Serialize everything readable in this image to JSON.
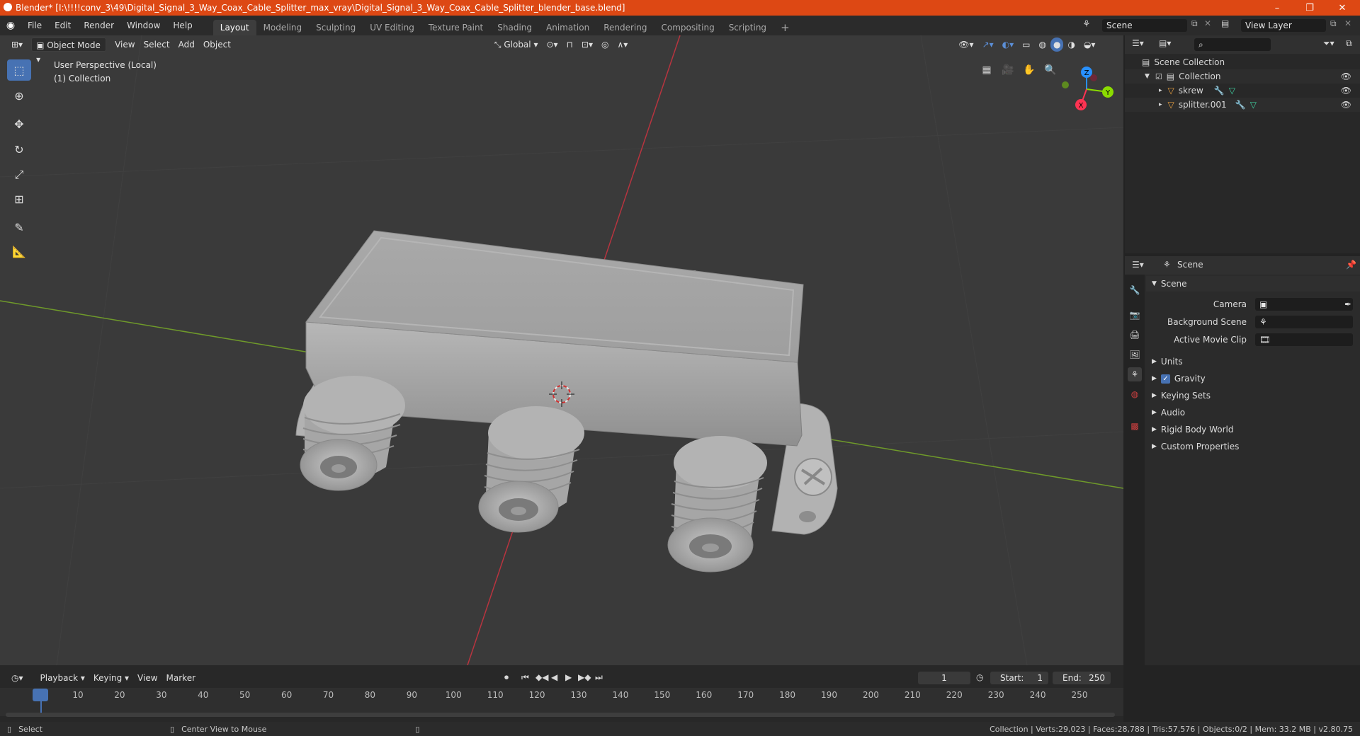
{
  "window": {
    "title": "Blender* [I:\\!!!!conv_3\\49\\Digital_Signal_3_Way_Coax_Cable_Splitter_max_vray\\Digital_Signal_3_Way_Coax_Cable_Splitter_blender_base.blend]",
    "minimize": "–",
    "maximize": "❐",
    "close": "✕"
  },
  "menu": [
    "File",
    "Edit",
    "Render",
    "Window",
    "Help"
  ],
  "workspaces": [
    "Layout",
    "Modeling",
    "Sculpting",
    "UV Editing",
    "Texture Paint",
    "Shading",
    "Animation",
    "Rendering",
    "Compositing",
    "Scripting"
  ],
  "workspace_add": "+",
  "scene_field": "Scene",
  "view_layer_field": "View Layer",
  "viewport": {
    "mode": "Object Mode",
    "menus": [
      "View",
      "Select",
      "Add",
      "Object"
    ],
    "transform_orientation": "Global",
    "overlay_line1": "User Perspective (Local)",
    "overlay_line2": "(1) Collection",
    "gizmo_axes": {
      "z": "Z",
      "y": "Y",
      "x": "X"
    }
  },
  "outliner": {
    "search_placeholder": "",
    "root": "Scene Collection",
    "collection": "Collection",
    "objects": [
      "skrew",
      "splitter.001"
    ]
  },
  "properties": {
    "header": "Scene",
    "panel_title": "Scene",
    "fields": [
      {
        "label": "Camera",
        "value": ""
      },
      {
        "label": "Background Scene",
        "value": ""
      },
      {
        "label": "Active Movie Clip",
        "value": ""
      }
    ],
    "sections": [
      "Units",
      "Gravity",
      "Keying Sets",
      "Audio",
      "Rigid Body World",
      "Custom Properties"
    ],
    "gravity_checked": true
  },
  "timeline": {
    "menus": [
      "Playback",
      "Keying",
      "View",
      "Marker"
    ],
    "current_frame": "1",
    "start_label": "Start:",
    "start": "1",
    "end_label": "End:",
    "end": "250",
    "ticks": [
      "1",
      "10",
      "20",
      "30",
      "40",
      "50",
      "60",
      "70",
      "80",
      "90",
      "100",
      "110",
      "120",
      "130",
      "140",
      "150",
      "160",
      "170",
      "180",
      "190",
      "200",
      "210",
      "220",
      "230",
      "240",
      "250"
    ]
  },
  "status": {
    "left": "Select",
    "middle": "Center View to Mouse",
    "right": "Collection | Verts:29,023 | Faces:28,788 | Tris:57,576 | Objects:0/2 | Mem: 33.2 MB | v2.80.75"
  },
  "colors": {
    "title_bar": "#dd4814",
    "accent": "#4772b3",
    "x_axis": "#ff3352",
    "y_axis": "#8bdc00",
    "z_axis": "#2890ff"
  }
}
